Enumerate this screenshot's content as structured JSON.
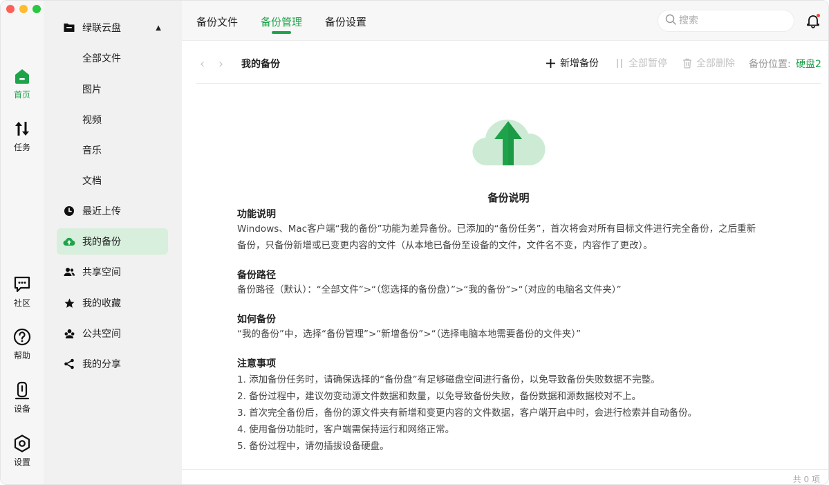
{
  "colors": {
    "accent": "#1fa34a",
    "accent_light": "#d7efdc",
    "disabled": "#c4c4c4"
  },
  "rail": {
    "items": [
      {
        "label": "首页",
        "icon": "home-icon"
      },
      {
        "label": "任务",
        "icon": "transfer-icon"
      },
      {
        "label": "社区",
        "icon": "chat-icon"
      },
      {
        "label": "帮助",
        "icon": "help-icon"
      },
      {
        "label": "设备",
        "icon": "device-icon"
      },
      {
        "label": "设置",
        "icon": "settings-icon"
      }
    ]
  },
  "sidebar": {
    "cloud": {
      "label": "绿联云盘",
      "icon": "folder-icon"
    },
    "sub_items": [
      {
        "label": "全部文件"
      },
      {
        "label": "图片"
      },
      {
        "label": "视频"
      },
      {
        "label": "音乐"
      },
      {
        "label": "文档"
      }
    ],
    "items": [
      {
        "label": "最近上传",
        "icon": "clock-icon"
      },
      {
        "label": "我的备份",
        "icon": "cloud-upload-icon"
      },
      {
        "label": "共享空间",
        "icon": "people-icon"
      },
      {
        "label": "我的收藏",
        "icon": "star-icon"
      },
      {
        "label": "公共空间",
        "icon": "group-icon"
      },
      {
        "label": "我的分享",
        "icon": "share-icon"
      }
    ]
  },
  "tabs": [
    {
      "label": "备份文件"
    },
    {
      "label": "备份管理"
    },
    {
      "label": "备份设置"
    }
  ],
  "search": {
    "placeholder": "搜索"
  },
  "toolbar": {
    "breadcrumb": "我的备份",
    "add_backup": "新增备份",
    "pause_all": "全部暂停",
    "delete_all": "全部删除",
    "location_label": "备份位置:",
    "location_value": "硬盘2"
  },
  "doc": {
    "title": "备份说明",
    "sections": [
      {
        "heading": "功能说明",
        "lines": [
          "Windows、Mac客户端“我的备份”功能为差异备份。已添加的“备份任务”，首次将会对所有目标文件进行完全备份，之后重新",
          "备份，只备份新增或已变更内容的文件（从本地已备份至设备的文件，文件名不变，内容作了更改）。"
        ]
      },
      {
        "heading": "备份路径",
        "lines": [
          "备份路径（默认）：“全部文件”>“（您选择的备份盘）”>“我的备份”>“（对应的电脑名文件夹）”"
        ]
      },
      {
        "heading": "如何备份",
        "lines": [
          "“我的备份”中，选择“备份管理”>“新增备份”>“（选择电脑本地需要备份的文件夹）”"
        ]
      },
      {
        "heading": "注意事项",
        "lines": [
          "1. 添加备份任务时，请确保选择的“备份盘”有足够磁盘空间进行备份，以免导致备份失败数据不完整。",
          "2. 备份过程中，建议勿变动源文件数据和数量，以免导致备份失败，备份数据和源数据校对不上。",
          "3. 首次完全备份后，备份的源文件夹有新增和变更内容的文件数据，客户端开启中时，会进行检索并自动备份。",
          "4. 使用备份功能时，客户端需保持运行和网络正常。",
          "5. 备份过程中，请勿插拔设备硬盘。"
        ]
      }
    ]
  },
  "footer": {
    "count": "共 0 项"
  }
}
